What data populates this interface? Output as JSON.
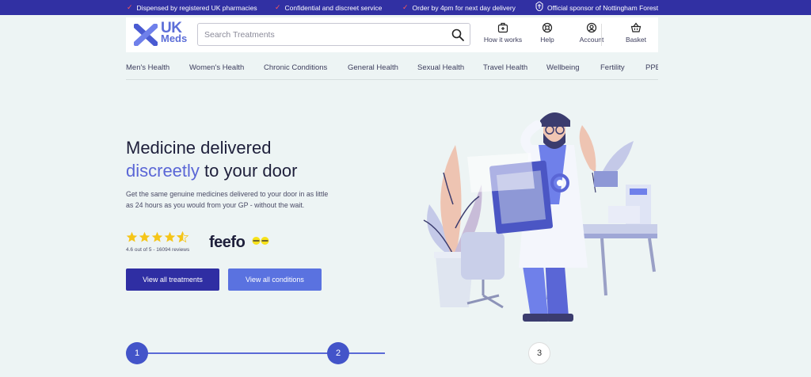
{
  "topbar": {
    "items": [
      "Dispensed by registered UK pharmacies",
      "Confidential and discreet service",
      "Order by 4pm for next day delivery",
      "Official sponsor of Nottingham Forest"
    ]
  },
  "header": {
    "logo_line1": "UK",
    "logo_line2": "Meds",
    "search_placeholder": "Search Treatments",
    "nav": [
      {
        "label": "How it works",
        "icon": "medkit-icon"
      },
      {
        "label": "Help",
        "icon": "lifebuoy-icon"
      },
      {
        "label": "Account",
        "icon": "user-icon"
      },
      {
        "label": "Basket",
        "icon": "basket-icon"
      }
    ]
  },
  "categories": [
    "Men's Health",
    "Women's Health",
    "Chronic Conditions",
    "General Health",
    "Sexual Health",
    "Travel Health",
    "Wellbeing",
    "Fertility",
    "PPE"
  ],
  "hero": {
    "title_line1": "Medicine delivered",
    "title_accent": "discreetly",
    "title_rest": " to your door",
    "subtitle": "Get the same genuine medicines delivered to your door in as little as 24 hours as you would from your GP - without the wait.",
    "rating_value": 4.6,
    "rating_text": "4.6 out of 5 - 16094 reviews",
    "feefo_logo": "feefo",
    "primary_button": "View all treatments",
    "secondary_button": "View all conditions"
  },
  "steps": [
    "1",
    "2",
    "3"
  ],
  "colors": {
    "topbar": "#3130a3",
    "accent": "#5a66d6",
    "primary_button": "#2f2ea3",
    "secondary_button": "#5a72e0",
    "background": "#edf4f4",
    "tick": "#ff5a5a",
    "star": "#f5c518"
  }
}
